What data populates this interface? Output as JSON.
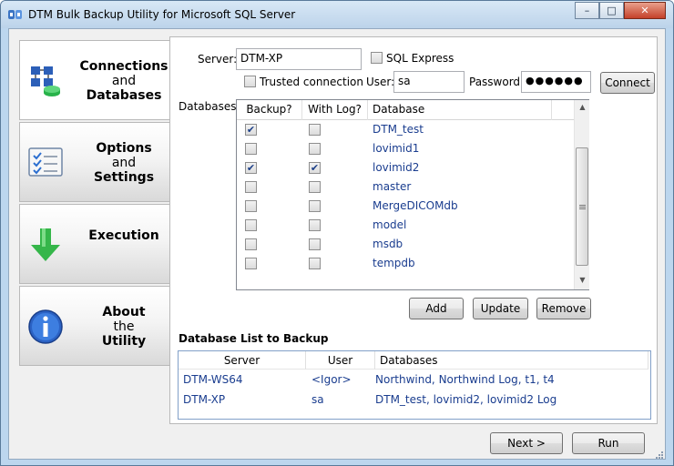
{
  "window": {
    "title": "DTM Bulk Backup Utility for Microsoft SQL Server",
    "minimize": "–",
    "maximize": "□",
    "close": "✕"
  },
  "nav": [
    {
      "line1": "Connections",
      "line2": "and",
      "line3": "Databases",
      "icon": "database-network-icon"
    },
    {
      "line1": "Options",
      "line2": "and",
      "line3": "Settings",
      "icon": "checklist-icon"
    },
    {
      "line1": "Execution",
      "line2": "",
      "line3": "",
      "icon": "green-down-arrow-icon"
    },
    {
      "line1": "About",
      "line2": "the",
      "line3": "Utility",
      "icon": "info-icon"
    }
  ],
  "connection": {
    "server_label": "Server:",
    "server_value": "DTM-XP",
    "sql_express_label": "SQL Express",
    "trusted_label": "Trusted connection",
    "user_label": "User:",
    "user_value": "sa",
    "password_label": "Password:",
    "password_value": "●●●●●●",
    "connect_label": "Connect"
  },
  "databases": {
    "label": "Databases:",
    "headers": [
      "Backup?",
      "With Log?",
      "Database"
    ],
    "rows": [
      {
        "backup": true,
        "log": false,
        "name": "DTM_test"
      },
      {
        "backup": false,
        "log": false,
        "name": "lovimid1"
      },
      {
        "backup": true,
        "log": true,
        "name": "lovimid2"
      },
      {
        "backup": false,
        "log": false,
        "name": "master"
      },
      {
        "backup": false,
        "log": false,
        "name": "MergeDICOMdb"
      },
      {
        "backup": false,
        "log": false,
        "name": "model"
      },
      {
        "backup": false,
        "log": false,
        "name": "msdb"
      },
      {
        "backup": false,
        "log": false,
        "name": "tempdb"
      }
    ],
    "add_label": "Add",
    "update_label": "Update",
    "remove_label": "Remove"
  },
  "backup_list": {
    "title": "Database List to Backup",
    "headers": [
      "Server",
      "User",
      "Databases"
    ],
    "rows": [
      {
        "server": "DTM-WS64",
        "user": "<Igor>",
        "databases": "Northwind, Northwind Log, t1, t4"
      },
      {
        "server": "DTM-XP",
        "user": "sa",
        "databases": "DTM_test, lovimid2, lovimid2 Log"
      }
    ]
  },
  "footer": {
    "next_label": "Next >",
    "run_label": "Run"
  }
}
